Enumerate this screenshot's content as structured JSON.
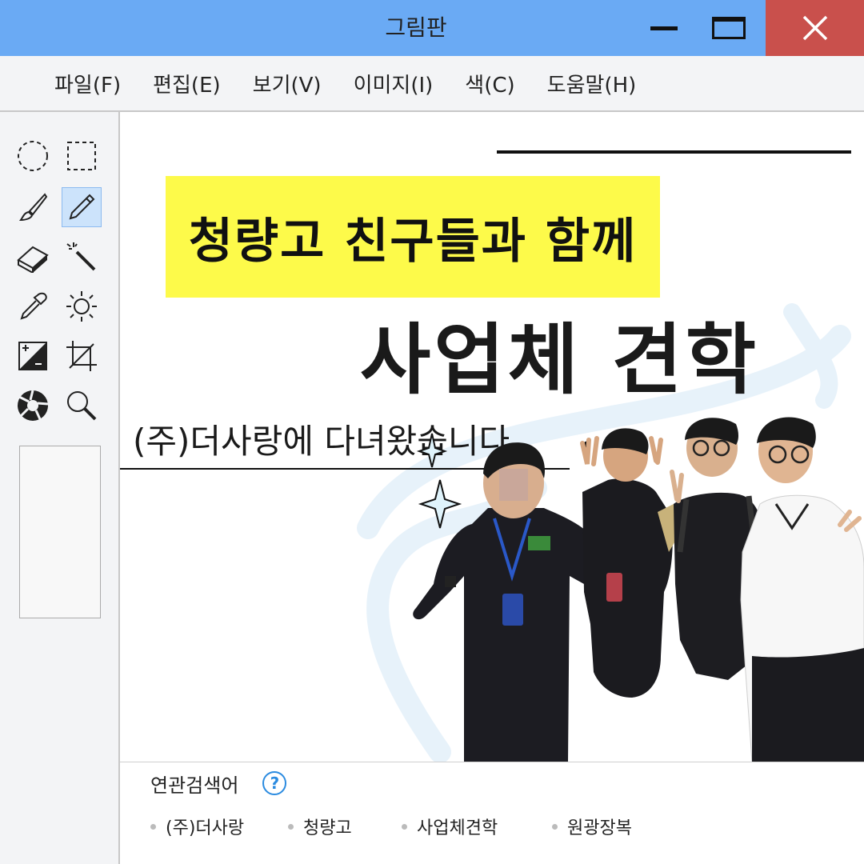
{
  "window": {
    "title": "그림판"
  },
  "menu": [
    "파일(F)",
    "편집(E)",
    "보기(V)",
    "이미지(I)",
    "색(C)",
    "도움말(H)"
  ],
  "tools": [
    "ellipse-select-icon",
    "rect-select-icon",
    "brush-icon",
    "pencil-icon",
    "eraser-icon",
    "magic-wand-icon",
    "eyedropper-icon",
    "brightness-icon",
    "contrast-icon",
    "crop-icon",
    "aperture-icon",
    "magnifier-icon"
  ],
  "active_tool": "pencil-icon",
  "canvas": {
    "headline": "청량고 친구들과 함께",
    "title": "사업체 견학",
    "subtitle": "(주)더사랑에 다녀왔습니다."
  },
  "related": {
    "label": "연관검색어",
    "help": "?",
    "keywords": [
      "(주)더사랑",
      "청량고",
      "사업체견학",
      "원광장복"
    ]
  },
  "colors": {
    "titlebar": "#6aaaf4",
    "close": "#c9504c",
    "highlight": "#fdfa4a",
    "help_accent": "#2b8be0"
  }
}
